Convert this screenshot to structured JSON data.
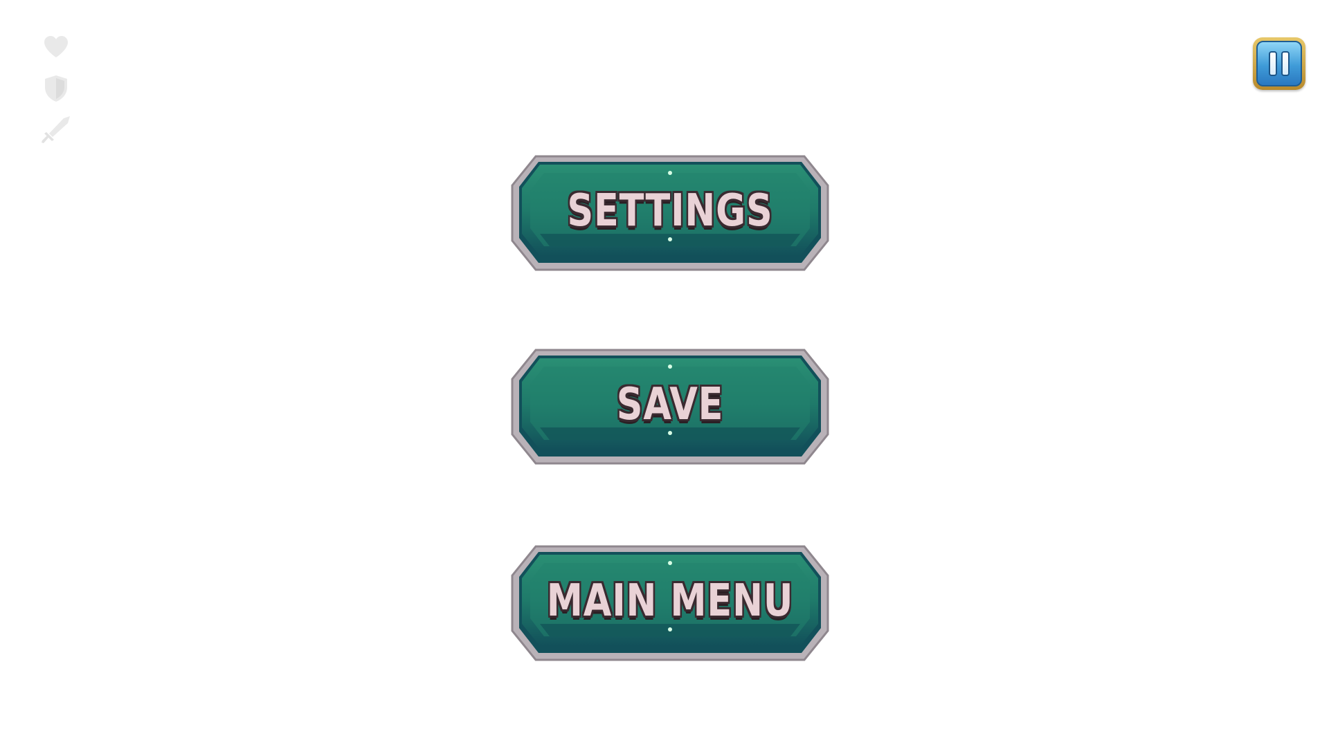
{
  "hud": {
    "icons": [
      "heart-icon",
      "shield-icon",
      "sword-icon"
    ],
    "icon_color": "#e6e6e6"
  },
  "pause": {
    "icon": "pause-icon"
  },
  "menu": {
    "settings_label": "SETTINGS",
    "save_label": "SAVE",
    "main_menu_label": "MAIN MENU"
  },
  "colors": {
    "button_green": "#1f7a6a",
    "button_dark": "#12505a",
    "frame_silver": "#c9c3c9",
    "label_fill": "#e9d2d6",
    "pause_gold": "#d4a84a",
    "pause_blue": "#3f9bd8"
  }
}
